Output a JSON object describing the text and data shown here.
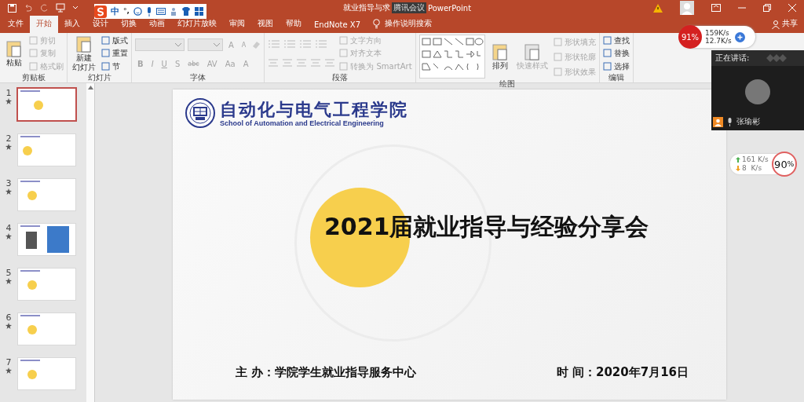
{
  "title_bar": {
    "title": "就业指导与求",
    "overlay_tag": "腾讯会议",
    "app_name": "PowerPoint"
  },
  "ime_toolbar": {
    "mode": "中",
    "punct": "°,"
  },
  "tabs": [
    {
      "label": "文件",
      "selected": false
    },
    {
      "label": "开始",
      "selected": true
    },
    {
      "label": "插入",
      "selected": false
    },
    {
      "label": "设计",
      "selected": false
    },
    {
      "label": "切换",
      "selected": false
    },
    {
      "label": "动画",
      "selected": false
    },
    {
      "label": "幻灯片放映",
      "selected": false
    },
    {
      "label": "审阅",
      "selected": false
    },
    {
      "label": "视图",
      "selected": false
    },
    {
      "label": "帮助",
      "selected": false
    },
    {
      "label": "EndNote X7",
      "selected": false
    }
  ],
  "tell_me": "操作说明搜索",
  "share": "共享",
  "ribbon": [
    {
      "label": "剪贴板",
      "columns": [
        [
          {
            "kind": "large",
            "lines": [
              "粘贴"
            ],
            "disabled": false
          }
        ],
        [
          {
            "kind": "small",
            "label": "剪切",
            "disabled": true
          },
          {
            "kind": "small",
            "label": "复制",
            "disabled": true
          },
          {
            "kind": "small",
            "label": "格式刷",
            "disabled": true
          }
        ]
      ]
    },
    {
      "label": "幻灯片",
      "columns": [
        [
          {
            "kind": "large",
            "lines": [
              "新建",
              "幻灯片"
            ],
            "disabled": false
          }
        ],
        [
          {
            "kind": "small",
            "label": "版式",
            "disabled": false
          },
          {
            "kind": "small",
            "label": "重置",
            "disabled": false
          },
          {
            "kind": "small",
            "label": "节",
            "disabled": false
          }
        ]
      ]
    },
    {
      "label": "字体",
      "columns": [
        [
          {
            "kind": "fontrow",
            "glyphs": [
              "A",
              "A"
            ]
          },
          {
            "kind": "glyphrow",
            "glyphs": [
              "B",
              "I",
              "U",
              "S",
              "abc",
              "AV",
              "Aa",
              "A"
            ]
          }
        ]
      ]
    },
    {
      "label": "段落",
      "columns": [
        [
          {
            "kind": "listicons"
          },
          {
            "kind": "alignicons"
          }
        ],
        [
          {
            "kind": "small",
            "label": "文字方向",
            "disabled": true
          },
          {
            "kind": "small",
            "label": "对齐文本",
            "disabled": true
          },
          {
            "kind": "small",
            "label": "转换为 SmartArt",
            "disabled": true
          }
        ]
      ]
    },
    {
      "label": "绘图",
      "columns": [
        [
          {
            "kind": "gallery"
          }
        ],
        [
          {
            "kind": "large",
            "lines": [
              "排列"
            ],
            "disabled": false
          }
        ],
        [
          {
            "kind": "large",
            "lines": [
              "快速样式"
            ],
            "disabled": true
          }
        ],
        [
          {
            "kind": "small",
            "label": "形状填充",
            "disabled": true
          },
          {
            "kind": "small",
            "label": "形状轮廓",
            "disabled": true
          },
          {
            "kind": "small",
            "label": "形状效果",
            "disabled": true
          }
        ]
      ]
    },
    {
      "label": "编辑",
      "columns": [
        [
          {
            "kind": "small",
            "label": "查找",
            "disabled": false
          },
          {
            "kind": "small",
            "label": "替换",
            "disabled": false
          },
          {
            "kind": "small",
            "label": "选择",
            "disabled": false
          }
        ]
      ]
    }
  ],
  "thumbnails": [
    {
      "number": "1",
      "kind": "title",
      "selected": true
    },
    {
      "number": "2",
      "kind": "agenda",
      "selected": false
    },
    {
      "number": "3",
      "kind": "section",
      "selected": false
    },
    {
      "number": "4",
      "kind": "photos",
      "selected": false
    },
    {
      "number": "5",
      "kind": "section",
      "selected": false
    },
    {
      "number": "6",
      "kind": "section",
      "selected": false
    },
    {
      "number": "7",
      "kind": "section",
      "selected": false
    }
  ],
  "slide": {
    "logo_cn": "自动化与电气工程学院",
    "logo_en": "School of Automation and Electrical Engineering",
    "title": "2021届就业指导与经验分享会",
    "host": "主 办：学院学生就业指导服务中心",
    "date": "时 间：2020年7月16日"
  },
  "net_widget": {
    "percent": "91%",
    "up": "159K/s",
    "down": "12.7K/s"
  },
  "meeting": {
    "label": "正在讲话:",
    "speaker": "张瑜彬"
  },
  "net_widget_2": {
    "up": "161 K/s",
    "down": "8  K/s",
    "percent": "90",
    "unit": "%"
  }
}
